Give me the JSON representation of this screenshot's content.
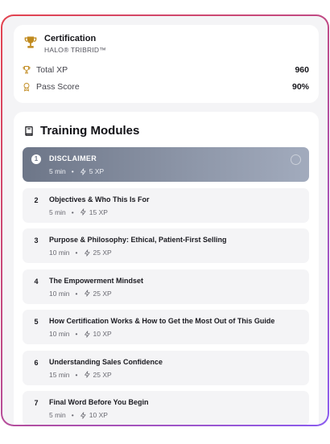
{
  "certification": {
    "title": "Certification",
    "subtitle": "HALO® TRIBRID™",
    "icon": "trophy-icon",
    "stats": [
      {
        "label": "Total XP",
        "value": "960",
        "icon": "trophy-icon"
      },
      {
        "label": "Pass Score",
        "value": "90%",
        "icon": "award-ribbon-icon"
      }
    ]
  },
  "modules": {
    "heading": "Training Modules",
    "heading_icon": "book-icon",
    "items": [
      {
        "number": "1",
        "title": "DISCLAIMER",
        "duration": "5 min",
        "xp": "5 XP",
        "active": true
      },
      {
        "number": "2",
        "title": "Objectives & Who This Is For",
        "duration": "5 min",
        "xp": "15 XP"
      },
      {
        "number": "3",
        "title": "Purpose & Philosophy: Ethical, Patient-First Selling",
        "duration": "10 min",
        "xp": "25 XP"
      },
      {
        "number": "4",
        "title": "The Empowerment Mindset",
        "duration": "10 min",
        "xp": "25 XP"
      },
      {
        "number": "5",
        "title": "How Certification Works & How to Get the Most Out of This Guide",
        "duration": "10 min",
        "xp": "10 XP"
      },
      {
        "number": "6",
        "title": "Understanding Sales Confidence",
        "duration": "15 min",
        "xp": "25 XP"
      },
      {
        "number": "7",
        "title": "Final Word Before You Begin",
        "duration": "5 min",
        "xp": "10 XP"
      }
    ],
    "separator": "•"
  },
  "colors": {
    "accent_gold": "#c08a1e",
    "active_module_start": "#6d7688",
    "active_module_end": "#a2abbd",
    "border_gradient_start": "#e3434f",
    "border_gradient_end": "#8a5bf0"
  }
}
